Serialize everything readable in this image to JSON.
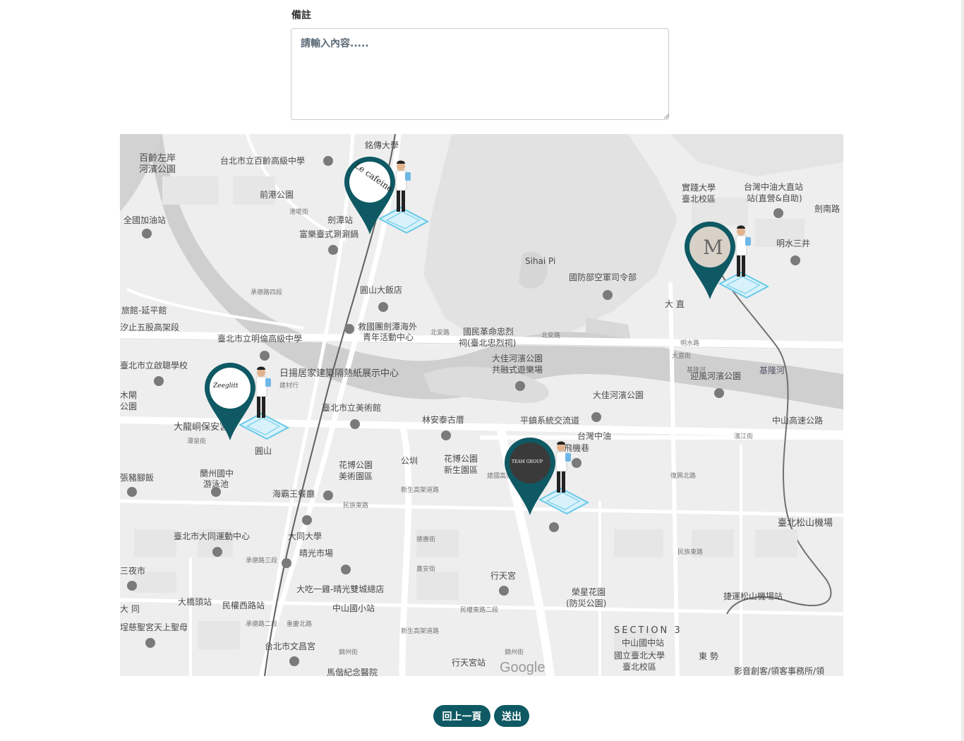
{
  "form": {
    "notes_label": "備註",
    "notes_placeholder": "請輸入內容.....",
    "notes_value": ""
  },
  "map": {
    "google_logo": "Google",
    "places": {
      "p1": "百齡左岸",
      "p2": "河濱公園",
      "p3": "台北市立百齡高級中學",
      "p4": "銘傳大學",
      "p5": "前港公園",
      "p6": "全國加油站",
      "p7": "劍潭站",
      "p8": "富樂臺式涮涮鍋",
      "p9": "圓山大飯店",
      "p10": "旅館-延平館",
      "p11": "汐止五股高架段",
      "p12": "救國團劍潭海外",
      "p13": "青年活動中心",
      "p14": "臺北市立明倫高級中學",
      "p15": "國民革命忠烈",
      "p16": "祠(臺北忠烈祠)",
      "p17": "Sihai Pi",
      "p18": "國防部空軍司令部",
      "p19": "實踐大學",
      "p20": "臺北校區",
      "p21": "台灣中油大直站",
      "p22": "站(直營&自助)",
      "p23": "劍南路",
      "p24": "明水三井",
      "p25": "大 直",
      "p26": "臺北市立啟聰學校",
      "p27": "日揚居家建築隔熱紙展示中心",
      "p28": "建材行",
      "p29": "大佳河濱公園",
      "p30": "共融式遊樂場",
      "p31": "迎風河濱公園",
      "p32": "基隆河",
      "p33": "大佳河濱公園",
      "p34": "木閘",
      "p35": "公園",
      "p36": "大龍峒保安宮",
      "p37": "臺北市立美術館",
      "p38": "林安泰古厝",
      "p39": "平鎮系統交流道",
      "p40": "台灣中油",
      "p41": "飛機巷",
      "p42": "中山高速公路",
      "p43": "圓山",
      "p44": "花博公園",
      "p45": "美術園區",
      "p46": "花博公園",
      "p47": "新生園區",
      "p48": "張豬腳飯",
      "p49": "蘭州國中",
      "p50": "游泳池",
      "p51": "海霸王餐廳",
      "p52": "臺北松山機場",
      "p53": "臺北市大同運動中心",
      "p54": "大同大學",
      "p55": "晴光市場",
      "p56": "三夜市",
      "p57": "大吃一雞-晴光雙城總店",
      "p58": "行天宮",
      "p59": "榮星花園",
      "p60": "(防災公園)",
      "p61": "大橋頭站",
      "p62": "民權西路站",
      "p63": "中山國小站",
      "p64": "捷運松山機場站",
      "p65": "SECTION 3",
      "p66": "中山國中站",
      "p67": "國立臺北大學",
      "p68": "臺北校區",
      "p69": "東 勢",
      "p70": "影音創客/領客事務所/領",
      "p71": "埕慈聖宮天上聖母",
      "p72": "台北市文昌宮",
      "p73": "行天宮站",
      "p74": "大 同",
      "p75": "馬偕紀念醫院",
      "p76": "基隆河",
      "p77": "明水路",
      "p78": "北安路",
      "p79": "北安路",
      "p80": "濱江街",
      "p81": "民族東路",
      "p82": "民權東路二段",
      "p83": "德惠街",
      "p84": "農安街",
      "p85": "錦州街",
      "p86": "錦州街",
      "p87": "大直街",
      "p88": "公圳",
      "p89": "建國高架道路",
      "p90": "新生高架道路",
      "p91": "新生高架道路",
      "p92": "承德路四段",
      "p93": "承德路三段",
      "p94": "承德路二段",
      "p95": "重慶北路",
      "p96": "民族東路",
      "p97": "復興北路",
      "p98": "潭泉街",
      "p99": "港墘街"
    },
    "markers": [
      {
        "brand": "Le cafeine",
        "color": "#0e5963"
      },
      {
        "brand": "M",
        "color": "#0e5963"
      },
      {
        "brand": "Zeeglitt",
        "color": "#0e5963"
      },
      {
        "brand": "TEAM GROUP",
        "color": "#0e5963"
      }
    ]
  },
  "actions": {
    "back_label": "回上一頁",
    "submit_label": "送出"
  },
  "colors": {
    "accent": "#0e5963",
    "map_bg": "#eeeeee"
  }
}
